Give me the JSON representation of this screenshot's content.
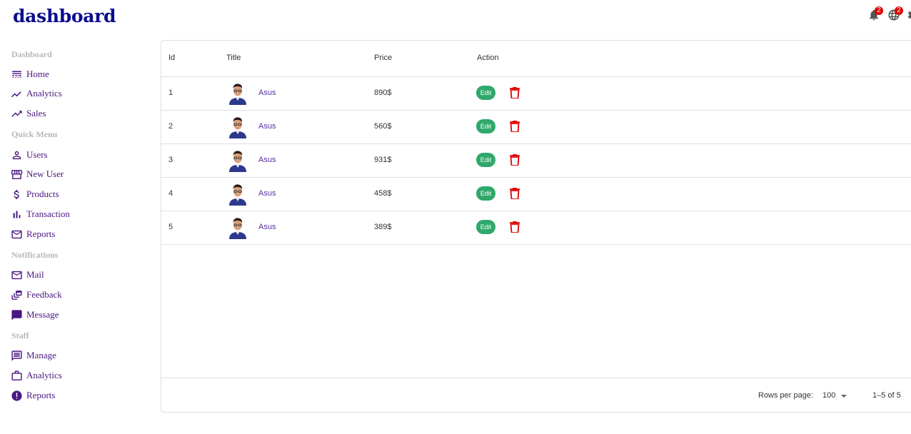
{
  "app": {
    "title": "dashboard"
  },
  "topbar": {
    "notifications": {
      "icon": "bell-icon",
      "badge": "2"
    },
    "language": {
      "icon": "globe-icon",
      "badge": "2"
    },
    "settings": {
      "icon": "gear-icon"
    }
  },
  "sidebar": {
    "sections": [
      {
        "title": "Dashboard",
        "items": [
          {
            "label": "Home",
            "icon": "home-line-icon"
          },
          {
            "label": "Analytics",
            "icon": "timeline-icon"
          },
          {
            "label": "Sales",
            "icon": "trending-up-icon"
          }
        ]
      },
      {
        "title": "Quick Menu",
        "items": [
          {
            "label": "Users",
            "icon": "person-icon"
          },
          {
            "label": "New User",
            "icon": "storefront-icon"
          },
          {
            "label": "Products",
            "icon": "dollar-icon"
          },
          {
            "label": "Transaction",
            "icon": "bar-chart-icon"
          },
          {
            "label": "Reports",
            "icon": "mail-icon"
          }
        ]
      },
      {
        "title": "Notifications",
        "items": [
          {
            "label": "Mail",
            "icon": "mail-icon"
          },
          {
            "label": "Feedback",
            "icon": "dynamic-feed-icon"
          },
          {
            "label": "Message",
            "icon": "chat-bubble-icon"
          }
        ]
      },
      {
        "title": "Staff",
        "items": [
          {
            "label": "Manage",
            "icon": "forum-icon"
          },
          {
            "label": "Analytics",
            "icon": "briefcase-icon"
          },
          {
            "label": "Reports",
            "icon": "report-icon"
          }
        ]
      }
    ]
  },
  "table": {
    "columns": [
      "Id",
      "Title",
      "Price",
      "Action"
    ],
    "rows": [
      {
        "id": "1",
        "title": "Asus",
        "price": "890$",
        "edit": "Edit"
      },
      {
        "id": "2",
        "title": "Asus",
        "price": "560$",
        "edit": "Edit"
      },
      {
        "id": "3",
        "title": "Asus",
        "price": "931$",
        "edit": "Edit"
      },
      {
        "id": "4",
        "title": "Asus",
        "price": "458$",
        "edit": "Edit"
      },
      {
        "id": "5",
        "title": "Asus",
        "price": "389$",
        "edit": "Edit"
      }
    ],
    "footer": {
      "rows_per_page_label": "Rows per page:",
      "rows_per_page_value": "100",
      "page_range": "1–5 of 5"
    }
  },
  "colors": {
    "logo": "#0b0b8f",
    "sidebar_item": "#4a1680",
    "section_title": "#b7b7b7",
    "edit_button": "#2fa86a",
    "delete_icon": "#e00000",
    "badge": "#e00000"
  }
}
